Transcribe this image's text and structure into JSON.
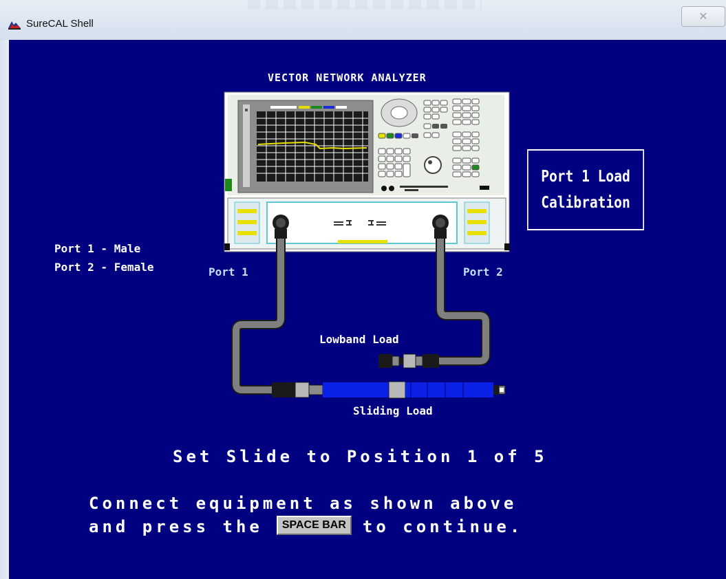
{
  "window": {
    "title": "SureCAL Shell",
    "close_label": "✕"
  },
  "screen": {
    "instrument_heading": "VECTOR NETWORK ANALYZER",
    "calibration_title_line1": "Port 1 Load",
    "calibration_title_line2": "Calibration",
    "port_note_line1": "Port 1 - Male",
    "port_note_line2": "Port 2 - Female",
    "port1_label": "Port 1",
    "port2_label": "Port 2",
    "lowband_label": "Lowband Load",
    "sliding_label": "Sliding Load",
    "slide_instruction": "Set Slide to Position 1 of 5",
    "connect_line1": "Connect equipment as shown above",
    "connect_line2_before": "and press the",
    "space_bar_label": "SPACE BAR",
    "connect_line2_after": "to continue."
  },
  "colors": {
    "background": "#000080",
    "text": "#ffffff",
    "port_label": "#bfe3ff",
    "cable": "#7f7f7f",
    "sliding_load": "#0b22e6",
    "trace": "#e8e000"
  },
  "icons": [
    "surecal-app-icon",
    "close-icon"
  ]
}
